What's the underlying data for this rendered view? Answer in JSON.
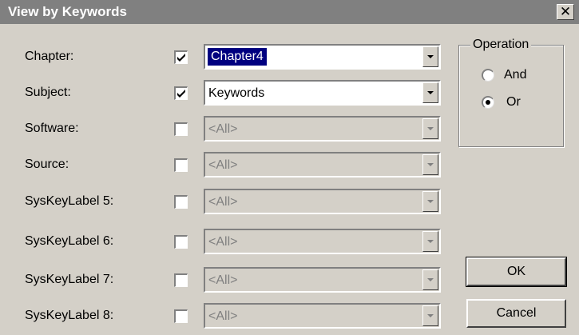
{
  "window": {
    "title": "View by Keywords",
    "close_glyph": "✕"
  },
  "rows": [
    {
      "label": "Chapter:",
      "checked": true,
      "value": "Chapter4",
      "enabled": true,
      "selected": true
    },
    {
      "label": "Subject:",
      "checked": true,
      "value": "Keywords",
      "enabled": true,
      "selected": false
    },
    {
      "label": "Software:",
      "checked": false,
      "value": "<All>",
      "enabled": false,
      "selected": false
    },
    {
      "label": "Source:",
      "checked": false,
      "value": "<All>",
      "enabled": false,
      "selected": false
    },
    {
      "label": "SysKeyLabel 5:",
      "checked": false,
      "value": "<All>",
      "enabled": false,
      "selected": false
    },
    {
      "label": "SysKeyLabel 6:",
      "checked": false,
      "value": "<All>",
      "enabled": false,
      "selected": false
    },
    {
      "label": "SysKeyLabel 7:",
      "checked": false,
      "value": "<All>",
      "enabled": false,
      "selected": false
    },
    {
      "label": "SysKeyLabel 8:",
      "checked": false,
      "value": "<All>",
      "enabled": false,
      "selected": false
    }
  ],
  "operation": {
    "title": "Operation",
    "options": [
      {
        "label": "And",
        "selected": false
      },
      {
        "label": "Or",
        "selected": true
      }
    ]
  },
  "buttons": {
    "ok": "OK",
    "cancel": "Cancel"
  },
  "colors": {
    "face": "#d4d0c8",
    "titlebar": "#808080",
    "selection": "#000080"
  }
}
